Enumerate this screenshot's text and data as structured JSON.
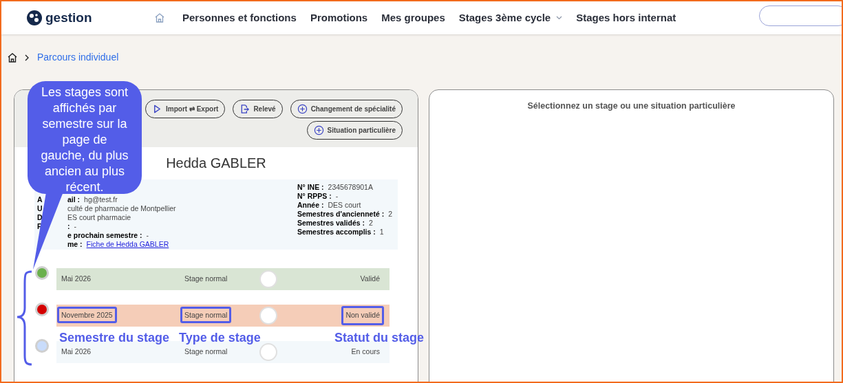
{
  "header": {
    "logo": "gestion",
    "nav": [
      {
        "label": "Personnes et fonctions",
        "dropdown": false
      },
      {
        "label": "Promotions",
        "dropdown": false
      },
      {
        "label": "Mes groupes",
        "dropdown": false
      },
      {
        "label": "Stages 3ème cycle",
        "dropdown": true
      },
      {
        "label": "Stages hors internat",
        "dropdown": false
      }
    ]
  },
  "breadcrumb": [
    "Parcours individuel"
  ],
  "toolbar": [
    {
      "label": "Import ⇄ Export"
    },
    {
      "label": "Relevé"
    },
    {
      "label": "Changement de spécialité"
    },
    {
      "label": "Situation particulière"
    }
  ],
  "student": {
    "name": "Hedda GABLER",
    "left_lines": [
      {
        "lead": "A",
        "label": "ail :",
        "value": "hg@test.fr"
      },
      {
        "lead": "U",
        "value": "culté de pharmacie de Montpellier"
      },
      {
        "lead": "D",
        "value": "ES court pharmacie"
      },
      {
        "lead": "F",
        "label": ":",
        "value": "-"
      },
      {
        "label": "e prochain semestre :",
        "value": "-"
      },
      {
        "label": "me :",
        "link": "Fiche de Hedda GABLER"
      }
    ],
    "right_lines": [
      {
        "label": "N° INE :",
        "value": "2345678901A"
      },
      {
        "label": "N° RPPS :",
        "value": "-"
      },
      {
        "label": "Année :",
        "value": "DES court"
      },
      {
        "label": "Semestres d'ancienneté :",
        "value": "2"
      },
      {
        "label": "Semestres validés :",
        "value": "2"
      },
      {
        "label": "Semestres accomplis :",
        "value": "1"
      }
    ]
  },
  "stages": [
    {
      "semester": "Mai 2026",
      "type": "Stage normal",
      "status": "Validé",
      "kind": "valid",
      "color": "#6ab04c",
      "highlighted": false
    },
    {
      "semester": "Novembre 2025",
      "type": "Stage normal",
      "status": "Non validé",
      "kind": "invalid",
      "color": "#d40000",
      "highlighted": true
    },
    {
      "semester": "Mai 2026",
      "type": "Stage normal",
      "status": "En cours",
      "kind": "ongoing",
      "color": "#c9dcfb",
      "highlighted": false
    }
  ],
  "callout": "Les stages sont affichés par semestre sur la page de gauche, du plus ancien au plus récent.",
  "annotations": [
    "Semestre du stage",
    "Type de stage",
    "Statut du stage"
  ],
  "detail_panel": {
    "message": "Sélectionnez un stage ou une situation particulière"
  }
}
